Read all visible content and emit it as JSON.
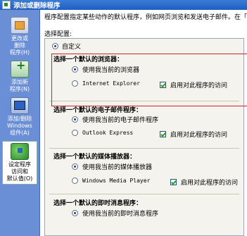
{
  "window": {
    "title": "添加或删除程序"
  },
  "sidebar": {
    "items": [
      {
        "label": "更改或\n删除\n程序(H)"
      },
      {
        "label": "添加新\n程序(N)"
      },
      {
        "label": "添加/删除\nWindows\n组件(A)"
      },
      {
        "label": "设定程序\n访问和\n默认值(O)"
      }
    ]
  },
  "main": {
    "intro": "程序配置指定某些动作的默认程序，例如网页浏览和发送电子邮件。在「开始」",
    "config_label": "选择配置:",
    "custom_option": "自定义",
    "groups": [
      {
        "title": "选择一个默认的浏览器：",
        "current": "使用我当前的浏览器",
        "program": "Internet Explorer",
        "enable": "启用对此程序的访问"
      },
      {
        "title": "选择一个默认的电子邮件程序：",
        "current": "使用我当前的电子邮件程序",
        "program": "Outlook Express",
        "enable": "启用对此程序的访问"
      },
      {
        "title": "选择一个默认的媒体播放器：",
        "current": "使用我当前的媒体播放器",
        "program": "Windows Media Player",
        "enable": "启用对此程序的访问"
      },
      {
        "title": "选择一个默认的即时消息程序：",
        "current": "使用我当前的即时消息程序"
      }
    ]
  }
}
